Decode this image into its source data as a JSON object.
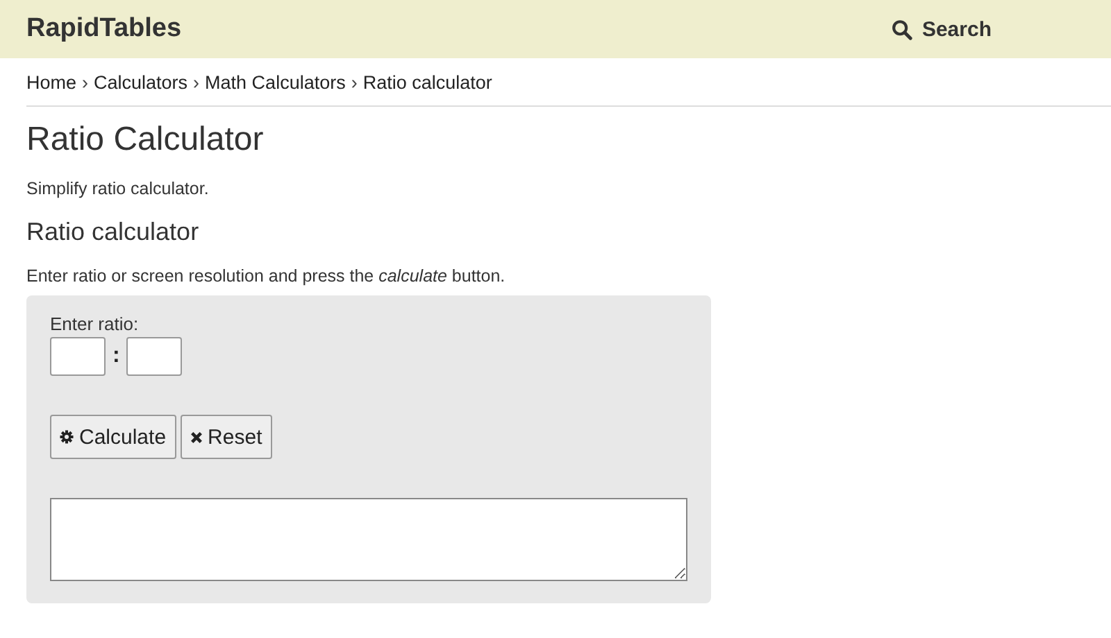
{
  "header": {
    "logo": "RapidTables",
    "search": "Search"
  },
  "breadcrumb": [
    {
      "label": "Home",
      "separator": "›"
    },
    {
      "label": "Calculators",
      "separator": "›"
    },
    {
      "label": "Math Calculators",
      "separator": "›"
    },
    {
      "label": "Ratio calculator"
    }
  ],
  "title": "Ratio Calculator",
  "intro": "Simplify ratio calculator.",
  "section_title": "Ratio calculator",
  "instructions": "Enter ratio or screen resolution and press the *calculate* button.",
  "form": {
    "label": "Enter ratio:",
    "separator": ":",
    "buttons": [
      {
        "kind": "calculate",
        "label": "Calculate"
      },
      {
        "kind": "reset",
        "label": "Reset"
      }
    ]
  }
}
